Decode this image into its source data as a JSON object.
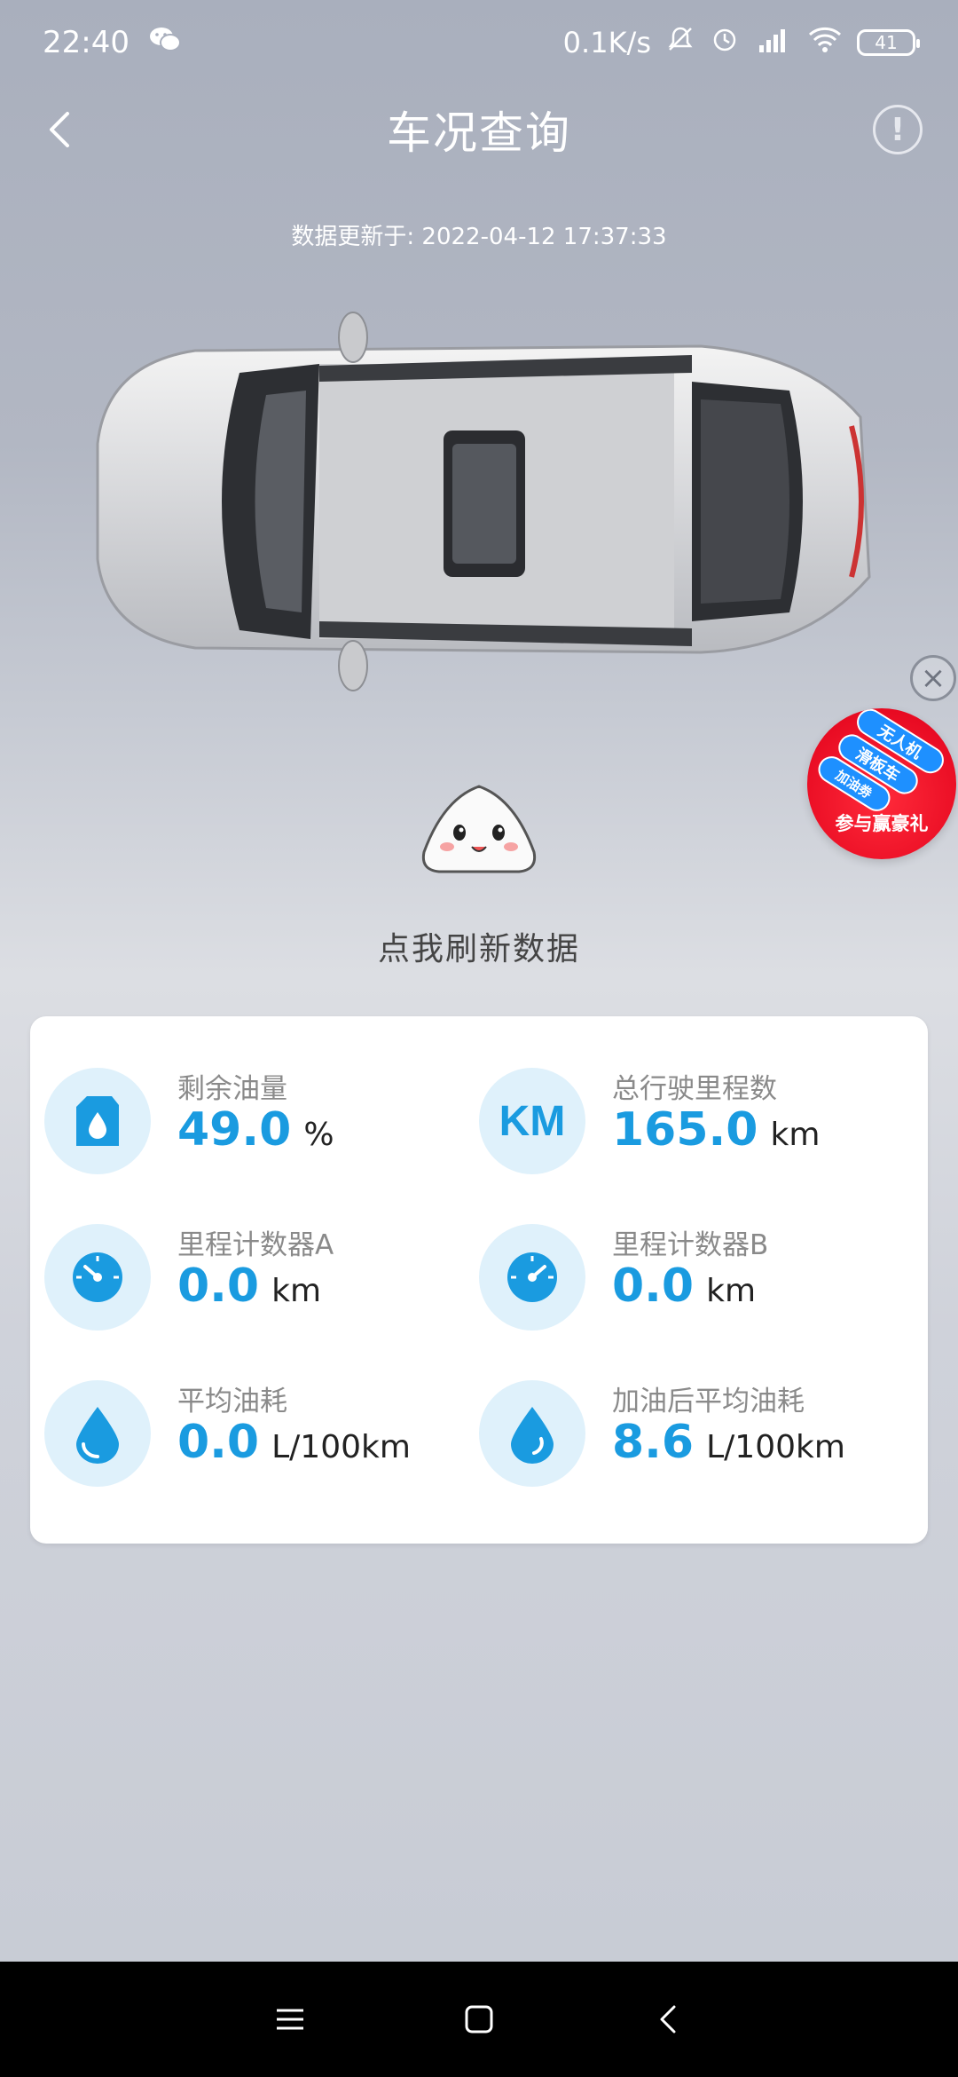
{
  "status_bar": {
    "time": "22:40",
    "network_speed": "0.1K/s",
    "battery": "41",
    "icons": [
      "wechat-icon",
      "mute-icon",
      "alarm-icon",
      "hd-signal-icon",
      "wifi-icon",
      "battery-icon"
    ]
  },
  "header": {
    "title": "车况查询",
    "back_icon": "chevron-left-icon",
    "info_icon": "info-icon",
    "info_glyph": "!"
  },
  "update": {
    "text": "数据更新于: 2022-04-12 17:37:33"
  },
  "promo": {
    "close_glyph": "×",
    "tags": [
      "无人机",
      "滑板车",
      "加油劵"
    ],
    "text": "参与赢豪礼"
  },
  "refresh": {
    "label": "点我刷新数据"
  },
  "metrics": [
    {
      "label": "剩余油量",
      "value": "49.0",
      "unit": "%",
      "icon": "fuel-tank-icon"
    },
    {
      "label": "总行驶里程数",
      "value": "165.0",
      "unit": "km",
      "icon": "km-icon",
      "icon_text": "KM"
    },
    {
      "label": "里程计数器A",
      "value": "0.0",
      "unit": "km",
      "icon": "speedometer-icon"
    },
    {
      "label": "里程计数器B",
      "value": "0.0",
      "unit": "km",
      "icon": "speedometer-icon"
    },
    {
      "label": "平均油耗",
      "value": "0.0",
      "unit": "L/100km",
      "icon": "drop-icon"
    },
    {
      "label": "加油后平均油耗",
      "value": "8.6",
      "unit": "L/100km",
      "icon": "drop-icon"
    }
  ],
  "colors": {
    "accent": "#1a9be0",
    "icon_bg": "#dff1fb",
    "promo_red": "#e0001a",
    "promo_blue": "#1e90ff"
  }
}
